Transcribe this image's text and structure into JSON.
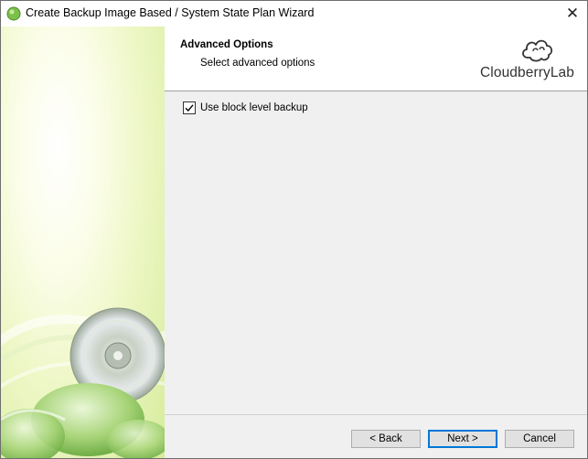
{
  "window": {
    "title": "Create Backup Image Based / System State Plan Wizard",
    "close_glyph": "✕"
  },
  "header": {
    "title": "Advanced Options",
    "subtitle": "Select advanced options",
    "brand_name": "CloudberryLab",
    "brand_icon": "cloud-icon"
  },
  "options": {
    "block_level_label": "Use block level backup",
    "block_level_checked": true
  },
  "buttons": {
    "back": "< Back",
    "next": "Next >",
    "cancel": "Cancel"
  },
  "colors": {
    "accent": "#0078d7",
    "side_panel_green": "#d6ec9c"
  }
}
